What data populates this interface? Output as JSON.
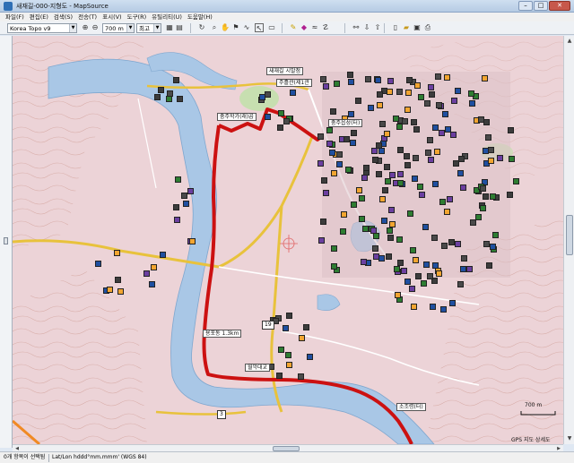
{
  "window": {
    "title": "새재길-000-지형도 - MapSource",
    "min_label": "–",
    "max_label": "□",
    "close_label": "✕"
  },
  "menu": [
    "파일(F)",
    "편집(E)",
    "검색(S)",
    "전송(T)",
    "표시(V)",
    "도구(R)",
    "유틸리티(U)",
    "도움말(H)"
  ],
  "toolbar": {
    "map_product": "Korea Topo v9",
    "zoom_level": "700 m",
    "detail_level": "최고",
    "icons": {
      "zoom_in": "zoom-in-icon",
      "zoom_out": "zoom-out-icon",
      "hand": "hand-icon",
      "select": "select-arrow-icon",
      "waypoint": "waypoint-flag-icon",
      "route": "route-icon",
      "measure": "measure-icon",
      "find": "binoculars-icon",
      "new": "new-file-icon",
      "open": "open-folder-icon",
      "save": "save-icon",
      "print": "print-icon"
    }
  },
  "map": {
    "labels": {
      "top_label": "새재길 시발점",
      "kiosk": "주흘관(제1관",
      "river_label": "충주학가(래)곱",
      "castle": "충주읍성(터)",
      "distance": "용포동 1.3km",
      "bridge": "월악대교",
      "bottom_right": "소조령(터)"
    },
    "road_number": "19",
    "road_number_2": "3",
    "scale": "700 m",
    "gps_link": "GPS 지도 상세도",
    "colors": {
      "terrain": "#ecd3d7",
      "water": "#a9c7e6",
      "route": "#cc1111",
      "road_yellow": "#e8c23c",
      "road_white": "#ffffff"
    }
  },
  "status": {
    "selection": "0개 항목이 선택됨",
    "coordinates": "Lat/Lon hddd°mm.mmm' (WGS 84)"
  }
}
